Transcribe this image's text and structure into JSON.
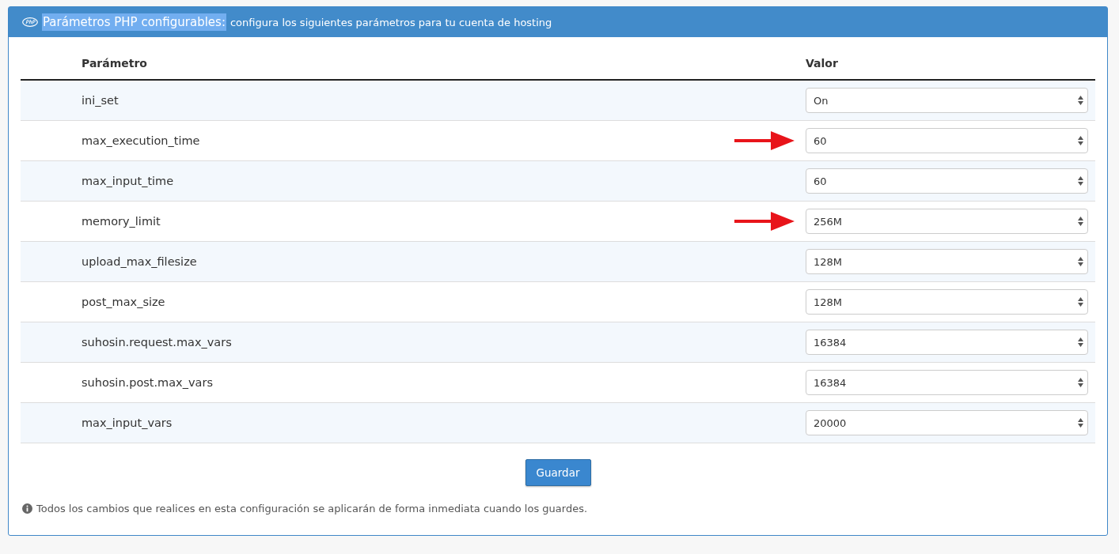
{
  "panel": {
    "title": "Parámetros PHP configurables:",
    "title_highlighted": true,
    "subtitle": "configura los siguientes parámetros para tu cuenta de hosting"
  },
  "table": {
    "columns": [
      "Parámetro",
      "Valor"
    ],
    "rows": [
      {
        "parameter": "ini_set",
        "value": "On",
        "arrow": false
      },
      {
        "parameter": "max_execution_time",
        "value": "60",
        "arrow": true
      },
      {
        "parameter": "max_input_time",
        "value": "60",
        "arrow": false
      },
      {
        "parameter": "memory_limit",
        "value": "256M",
        "arrow": true
      },
      {
        "parameter": "upload_max_filesize",
        "value": "128M",
        "arrow": false
      },
      {
        "parameter": "post_max_size",
        "value": "128M",
        "arrow": false
      },
      {
        "parameter": "suhosin.request.max_vars",
        "value": "16384",
        "arrow": false
      },
      {
        "parameter": "suhosin.post.max_vars",
        "value": "16384",
        "arrow": false
      },
      {
        "parameter": "max_input_vars",
        "value": "20000",
        "arrow": false
      }
    ]
  },
  "save_button": "Guardar",
  "note": "Todos los cambios que realices en esta configuración se aplicarán de forma inmediata cuando los guardes."
}
